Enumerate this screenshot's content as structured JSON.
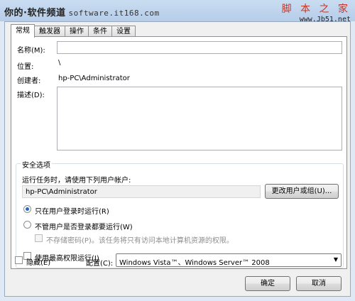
{
  "watermark": {
    "left": "你的·软件频道",
    "site": "software.it168.com",
    "right_title": "脚 本 之 家",
    "right_site": "www.Jb51.net"
  },
  "tabs": [
    {
      "label": "常规",
      "active": true
    },
    {
      "label": "触发器",
      "active": false
    },
    {
      "label": "操作",
      "active": false
    },
    {
      "label": "条件",
      "active": false
    },
    {
      "label": "设置",
      "active": false
    }
  ],
  "general": {
    "name_label": "名称(M):",
    "name_value": "",
    "location_label": "位置:",
    "location_value": "\\",
    "author_label": "创建者:",
    "author_value": "hp-PC\\Administrator",
    "description_label": "描述(D):",
    "description_value": ""
  },
  "security": {
    "group_title": "安全选项",
    "run_as_label": "运行任务时，请使用下列用户帐户:",
    "run_as_value": "hp-PC\\Administrator",
    "change_user_button": "更改用户或组(U)...",
    "radio_logged_on": "只在用户登录时运行(R)",
    "radio_logged_on_selected": true,
    "radio_whether": "不管用户是否登录都要运行(W)",
    "no_store_password": "不存储密码(P)。该任务将只有访问本地计算机资源的权限。",
    "highest_privileges": "使用最高权限运行(I)"
  },
  "bottom": {
    "hidden_label": "隐藏(E)",
    "config_label": "配置(C):",
    "config_value": "Windows Vista™、Windows Server™ 2008",
    "ok_button": "确定",
    "cancel_button": "取消"
  }
}
